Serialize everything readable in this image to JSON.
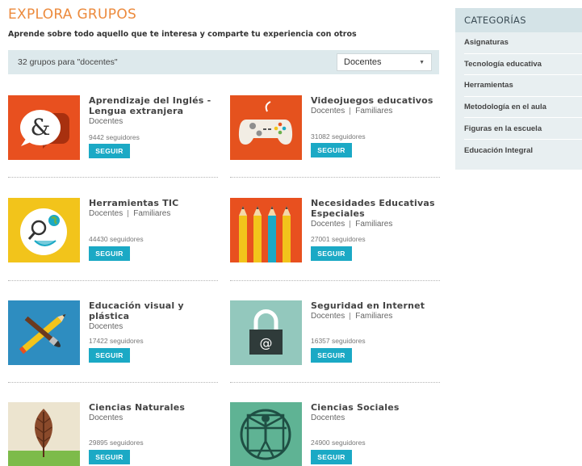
{
  "header": {
    "title": "EXPLORA GRUPOS",
    "subtitle": "Aprende sobre todo aquello que te interesa y comparte tu experiencia con otros"
  },
  "filter": {
    "count_text": "32 grupos para \"docentes\"",
    "selected": "Docentes"
  },
  "groups": [
    {
      "name_line1": "Aprendizaje del Inglés -",
      "name_line2": "Lengua extranjera",
      "tag1": "Docentes",
      "tag2": "",
      "followers": "9442 seguidores",
      "button": "SEGUIR",
      "icon": "ampersand-speech-bubble-icon",
      "color": "#e8501f"
    },
    {
      "name_line1": "Videojuegos educativos",
      "name_line2": "",
      "tag1": "Docentes",
      "tag2": "Familiares",
      "followers": "31082 seguidores",
      "button": "SEGUIR",
      "icon": "gamepad-icon",
      "color": "#e5521e"
    },
    {
      "name_line1": "Herramientas TIC",
      "name_line2": "",
      "tag1": "Docentes",
      "tag2": "Familiares",
      "followers": "44430 seguidores",
      "button": "SEGUIR",
      "icon": "magnifier-globe-icon",
      "color": "#f2c41b"
    },
    {
      "name_line1": "Necesidades Educativas",
      "name_line2": "Especiales",
      "tag1": "Docentes",
      "tag2": "Familiares",
      "followers": "27001 seguidores",
      "button": "SEGUIR",
      "icon": "pencils-icon",
      "color": "#e8501f"
    },
    {
      "name_line1": "Educación visual y",
      "name_line2": "plástica",
      "tag1": "Docentes",
      "tag2": "",
      "followers": "17422 seguidores",
      "button": "SEGUIR",
      "icon": "brush-pencil-cross-icon",
      "color": "#2e8dc0"
    },
    {
      "name_line1": "Seguridad en Internet",
      "name_line2": "",
      "tag1": "Docentes",
      "tag2": "Familiares",
      "followers": "16357 seguidores",
      "button": "SEGUIR",
      "icon": "padlock-at-icon",
      "color": "#93c8bd"
    },
    {
      "name_line1": "Ciencias Naturales",
      "name_line2": "",
      "tag1": "Docentes",
      "tag2": "",
      "followers": "29895 seguidores",
      "button": "SEGUIR",
      "icon": "leaf-icon",
      "color": "#ece4cf"
    },
    {
      "name_line1": "Ciencias Sociales",
      "name_line2": "",
      "tag1": "Docentes",
      "tag2": "",
      "followers": "24900 seguidores",
      "button": "SEGUIR",
      "icon": "vitruvian-man-icon",
      "color": "#5fb394"
    }
  ],
  "sidebar": {
    "title": "CATEGORÍAS",
    "items": [
      {
        "label": "Asignaturas"
      },
      {
        "label": "Tecnología educativa"
      },
      {
        "label": "Herramientas"
      },
      {
        "label": "Metodología en el aula"
      },
      {
        "label": "Figuras en la escuela"
      },
      {
        "label": "Educación Integral"
      }
    ]
  },
  "colors": {
    "title_orange": "#ec8a3c",
    "button_blue": "#1ba9c5",
    "filter_bg": "#dde9ec",
    "sidebar_bg": "#e8eff1"
  }
}
